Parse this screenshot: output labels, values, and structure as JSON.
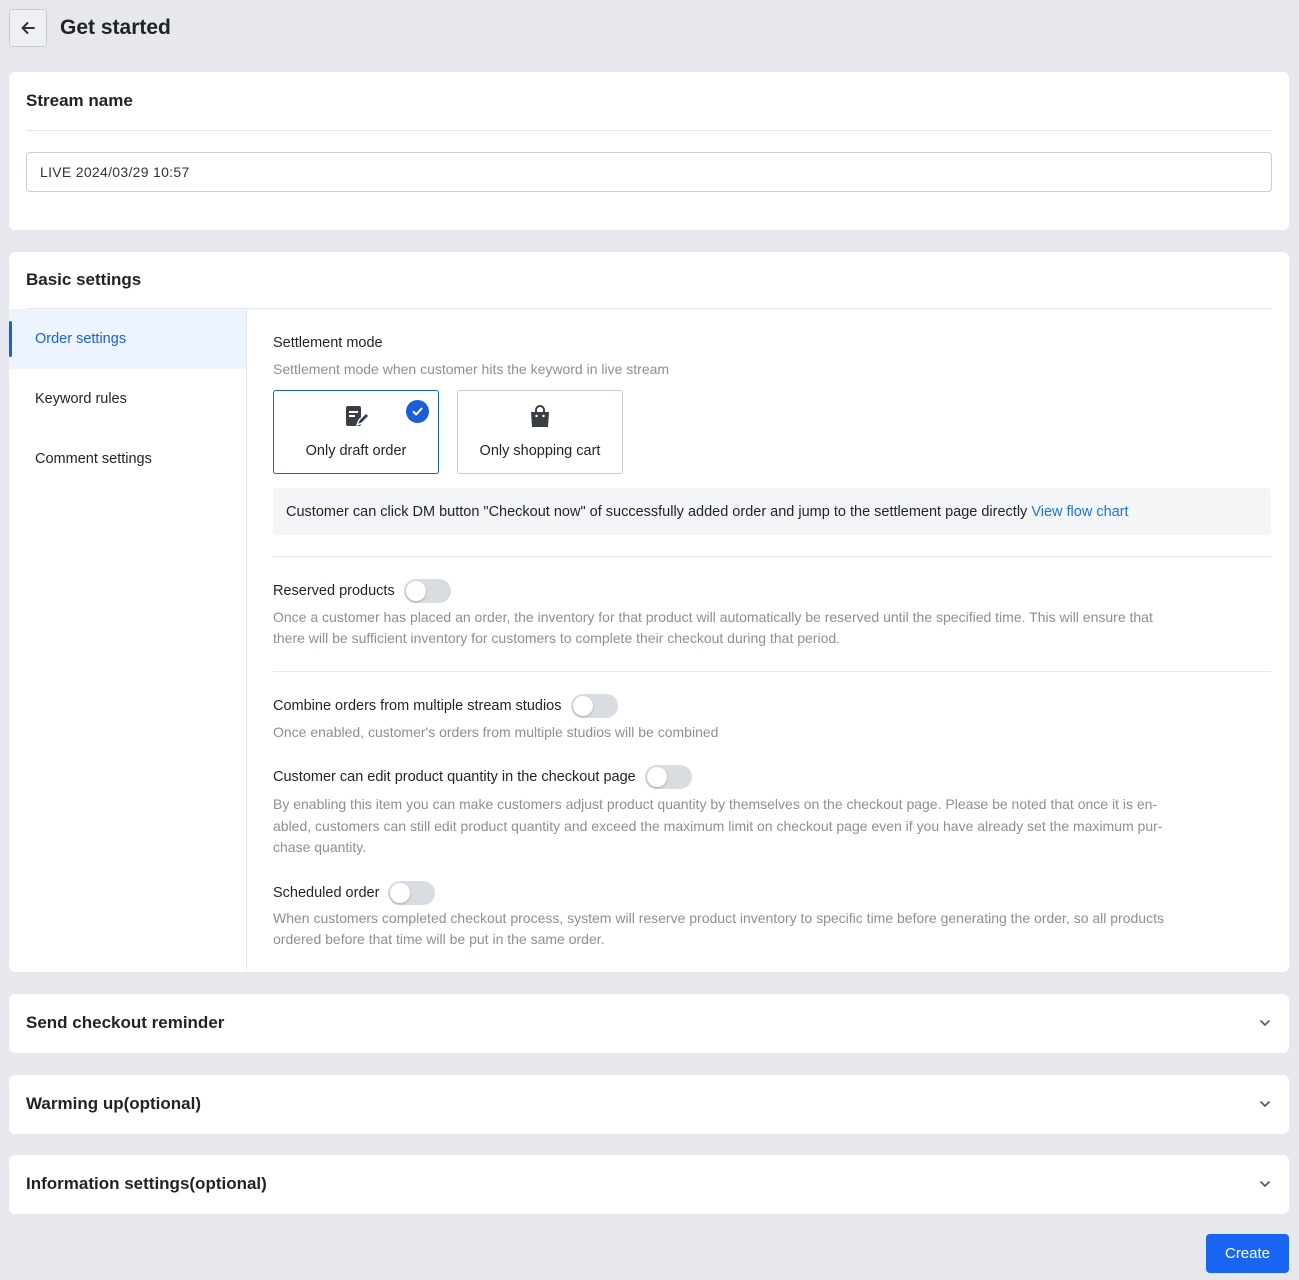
{
  "header": {
    "title": "Get started"
  },
  "stream_name": {
    "title": "Stream name",
    "value": "LIVE 2024/03/29 10:57"
  },
  "basic_settings": {
    "title": "Basic settings",
    "nav": [
      {
        "label": "Order settings",
        "active": true
      },
      {
        "label": "Keyword rules",
        "active": false
      },
      {
        "label": "Comment settings",
        "active": false
      }
    ],
    "settlement": {
      "label": "Settlement mode",
      "desc": "Settlement mode when customer hits the keyword in live stream",
      "options": [
        {
          "label": "Only draft order",
          "icon": "draft-order-icon",
          "selected": true
        },
        {
          "label": "Only shopping cart",
          "icon": "shopping-bag-icon",
          "selected": false
        }
      ],
      "info": "Customer can click DM button \"Checkout now\" of successfully added order and jump to the settlement page directly",
      "info_link": "View flow chart"
    },
    "reserved": {
      "label": "Reserved products",
      "enabled": false,
      "desc_1": "Once a customer has placed an order, the inventory for that product will automatically be reserved until the specified time. This will ensure that",
      "desc_2": "there will be sufficient inventory for customers to complete their checkout during that period."
    },
    "combine": {
      "label": "Combine orders from multiple stream studios",
      "enabled": false,
      "desc": "Once enabled, customer's orders from multiple studios will be combined"
    },
    "edit_qty": {
      "label": "Customer can edit product quantity in the checkout page",
      "enabled": false,
      "desc_1": "By enabling this item you can make customers adjust product quantity by themselves on the checkout page. Please be noted that once it is en-",
      "desc_2": "abled, customers can still edit product quantity and exceed the maximum limit on checkout page even if you have already set the maximum pur-",
      "desc_3": "chase quantity."
    },
    "scheduled": {
      "label": "Scheduled order",
      "enabled": false,
      "desc_1": "When customers completed checkout process, system will reserve product inventory to specific time before generating the order, so all products",
      "desc_2": "ordered before that time will be put in the same order."
    }
  },
  "sections": {
    "checkout_reminder": "Send checkout reminder",
    "warming_up": "Warming up(optional)",
    "information": "Information settings(optional)"
  },
  "actions": {
    "create": "Create"
  },
  "colors": {
    "primary": "#1a66f2",
    "link": "#1a73e8",
    "background": "#e6e8ed"
  }
}
